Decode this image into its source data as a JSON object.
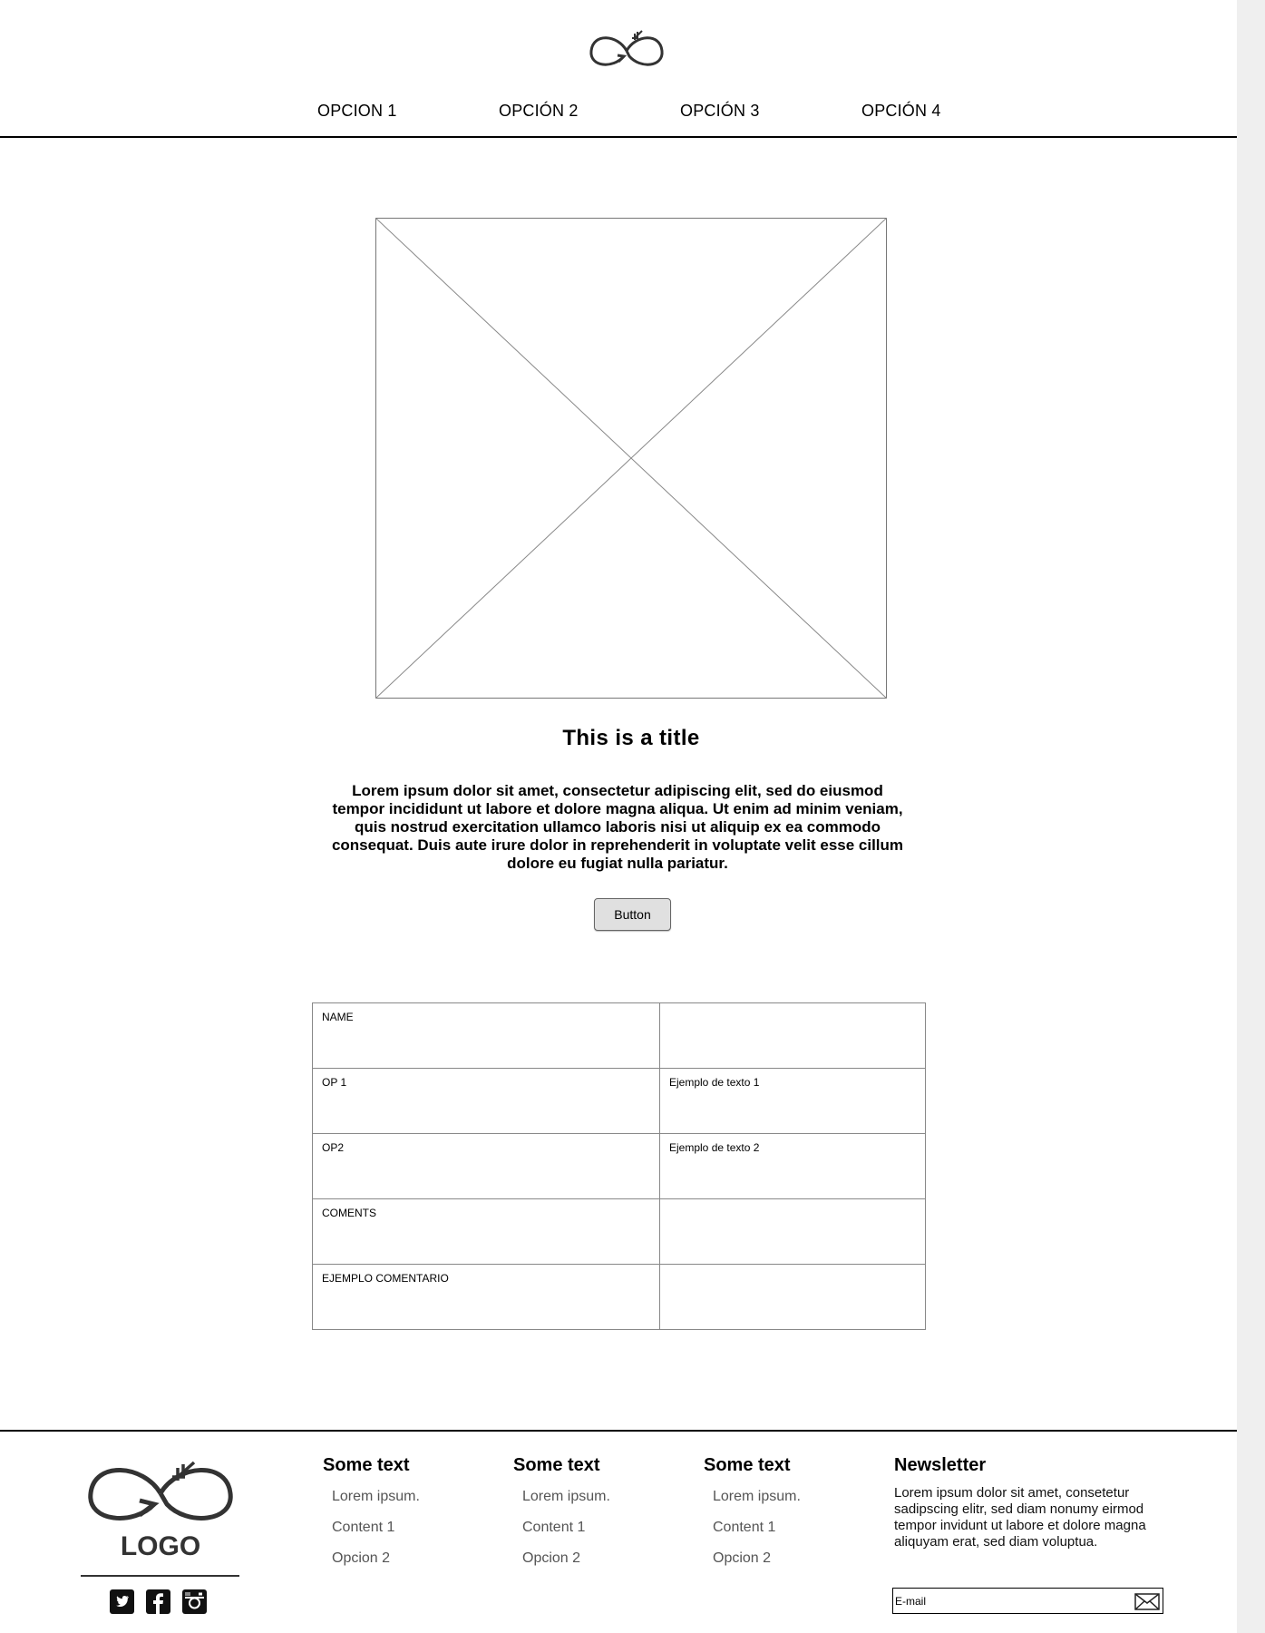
{
  "header": {
    "logo_icon": "infinity-arrow-logo",
    "nav": [
      {
        "label": "OPCION 1"
      },
      {
        "label": "OPCIÓN 2"
      },
      {
        "label": "OPCIÓN 3"
      },
      {
        "label": "OPCIÓN 4"
      }
    ]
  },
  "hero": {
    "image_icon": "image-placeholder",
    "title": "This is a title",
    "text": "Lorem ipsum dolor sit amet, consectetur adipiscing elit, sed do eiusmod tempor incididunt ut labore et dolore magna aliqua. Ut enim ad minim veniam, quis nostrud exercitation ullamco laboris nisi ut aliquip ex ea commodo consequat. Duis aute irure dolor in reprehenderit in voluptate velit esse cillum dolore eu fugiat nulla pariatur.",
    "button_label": "Button"
  },
  "table": {
    "rows": [
      [
        "NAME",
        ""
      ],
      [
        "OP 1",
        "Ejemplo de texto 1"
      ],
      [
        "OP2",
        "Ejemplo de texto 2"
      ],
      [
        "COMENTS",
        ""
      ],
      [
        "EJEMPLO COMENTARIO",
        ""
      ]
    ]
  },
  "footer": {
    "logo_text": "LOGO",
    "social_icons": [
      "twitter-icon",
      "facebook-icon",
      "instagram-icon"
    ],
    "columns": [
      {
        "title": "Some text",
        "links": [
          "Lorem ipsum.",
          "Content 1",
          "Opcion 2"
        ]
      },
      {
        "title": "Some text",
        "links": [
          "Lorem ipsum.",
          "Content 1",
          "Opcion 2"
        ]
      },
      {
        "title": "Some text",
        "links": [
          "Lorem ipsum.",
          "Content 1",
          "Opcion 2"
        ]
      }
    ],
    "newsletter": {
      "title": "Newsletter",
      "text": "Lorem ipsum dolor sit amet, consetetur sadipscing elitr, sed diam nonumy eirmod tempor invidunt ut labore et dolore magna aliquyam erat, sed diam voluptua.",
      "email_placeholder": "E-mail",
      "send_icon": "envelope-icon"
    }
  },
  "colors": {
    "text": "#000000",
    "muted_text": "#555555",
    "button_bg": "#e0e0e0",
    "border": "#888888",
    "scrollbar": "#efefef"
  }
}
